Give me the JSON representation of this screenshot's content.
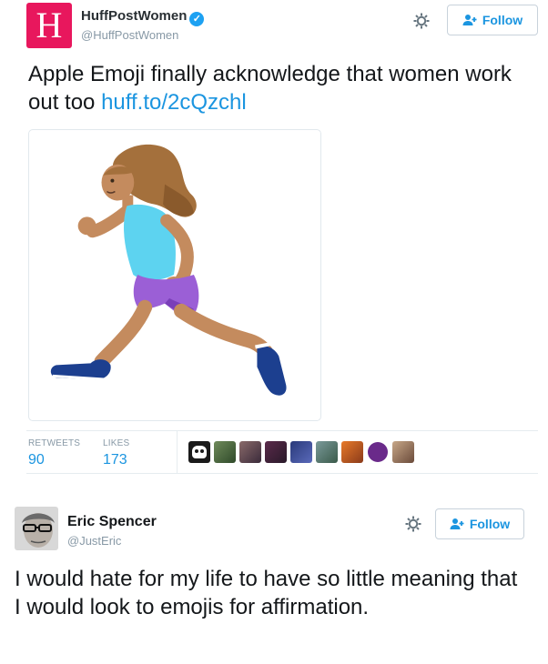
{
  "tweet1": {
    "avatar_letter": "H",
    "display_name": "HuffPostWomen",
    "handle": "@HuffPostWomen",
    "follow_label": "Follow",
    "text": "Apple Emoji finally acknowledge that women work out too ",
    "link_text": "huff.to/2cQzchl",
    "media_description": "woman running emoji",
    "retweets_label": "RETWEETS",
    "retweets_count": "90",
    "likes_label": "LIKES",
    "likes_count": "173",
    "liker_avatars": 9
  },
  "tweet2": {
    "display_name": "Eric Spencer",
    "handle": "@JustEric",
    "follow_label": "Follow",
    "text": "I would hate for my life to have so little meaning that I would look to emojis for affirmation."
  },
  "colors": {
    "link_blue": "#1b95e0",
    "verified_blue": "#1da1f2",
    "huffpost_pink": "#e8175d",
    "muted_gray": "#8899a6"
  },
  "icons": [
    "verified-badge-icon",
    "gear-icon",
    "follow-person-plus-icon"
  ]
}
